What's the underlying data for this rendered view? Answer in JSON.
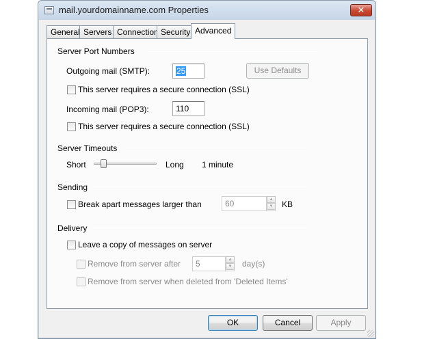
{
  "window": {
    "title": "mail.yourdomainname.com Properties",
    "close_icon": "close-icon",
    "close_glyph": "✕"
  },
  "tabs": [
    {
      "label": "General",
      "active": false
    },
    {
      "label": "Servers",
      "active": false
    },
    {
      "label": "Connection",
      "active": false
    },
    {
      "label": "Security",
      "active": false
    },
    {
      "label": "Advanced",
      "active": true
    }
  ],
  "server_ports": {
    "heading": "Server Port Numbers",
    "outgoing_label": "Outgoing mail (SMTP):",
    "outgoing_value": "25",
    "use_defaults_label": "Use Defaults",
    "ssl_outgoing_label": "This server requires a secure connection (SSL)",
    "ssl_outgoing_checked": false,
    "incoming_label": "Incoming mail (POP3):",
    "incoming_value": "110",
    "ssl_incoming_label": "This server requires a secure connection (SSL)",
    "ssl_incoming_checked": false
  },
  "timeouts": {
    "heading": "Server Timeouts",
    "short_label": "Short",
    "long_label": "Long",
    "value_text": "1 minute"
  },
  "sending": {
    "heading": "Sending",
    "break_apart_label": "Break apart messages larger than",
    "break_apart_checked": false,
    "size_value": "60",
    "unit_label": "KB"
  },
  "delivery": {
    "heading": "Delivery",
    "leave_copy_label": "Leave a copy of messages on server",
    "leave_copy_checked": false,
    "remove_after_label": "Remove from server after",
    "remove_after_value": "5",
    "days_label": "day(s)",
    "remove_deleted_label": "Remove from server when deleted from 'Deleted Items'"
  },
  "buttons": {
    "ok": "OK",
    "cancel": "Cancel",
    "apply": "Apply"
  },
  "spinner_glyphs": {
    "up": "▲",
    "down": "▼"
  }
}
